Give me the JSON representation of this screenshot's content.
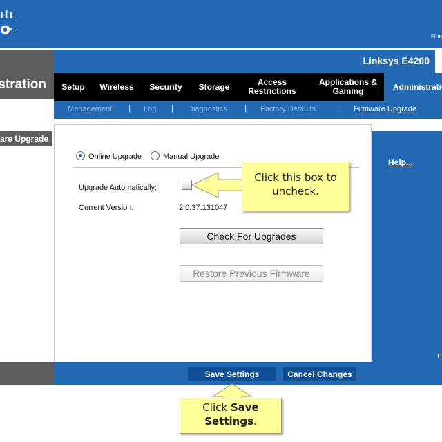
{
  "header": {
    "logo_bars": "ılı",
    "logo_text": "o",
    "corner_text": "Firm",
    "product_name": "Linksys E4200",
    "section_title": "stration"
  },
  "tabs": [
    {
      "label": "Setup"
    },
    {
      "label": "Wireless"
    },
    {
      "label": "Security"
    },
    {
      "label": "Storage"
    },
    {
      "label": "Access Restrictions"
    },
    {
      "label": "Applications & Gaming"
    },
    {
      "label": "Administratio"
    }
  ],
  "subnav": {
    "items": [
      {
        "label": "Management"
      },
      {
        "label": "Log"
      },
      {
        "label": "Diagnostics"
      },
      {
        "label": "Factory Defaults"
      },
      {
        "label": "Firmware Upgrade"
      }
    ],
    "separator": "|"
  },
  "sidebar": {
    "label": "are Upgrade"
  },
  "form": {
    "online_upgrade_label": "Online Upgrade",
    "manual_upgrade_label": "Manual Upgrade",
    "upgrade_auto_label": "Upgrade Automatically:",
    "current_version_label": "Current Version:",
    "current_version_value": "2.0.37.131047",
    "check_upgrades_label": "Check For Upgrades",
    "restore_firmware_label": "Restore Previous Firmware"
  },
  "help": {
    "label": "Help..."
  },
  "footer": {
    "save_label": "Save Settings",
    "cancel_label": "Cancel Changes"
  },
  "callouts": {
    "top_line1": "Click this box to",
    "top_line2": "uncheck.",
    "bottom_prefix": "Click ",
    "bottom_bold1": "Save",
    "bottom_bold2": "Settings",
    "bottom_suffix": "."
  },
  "colors": {
    "brand_blue": "#2369b3",
    "dark_gray": "#5e5e5e",
    "callout_yellow": "#ffff99"
  }
}
